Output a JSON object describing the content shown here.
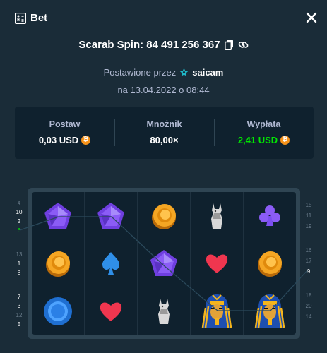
{
  "header": {
    "title": "Bet",
    "bet_icon": "bet-slip-icon",
    "close_icon": "close-icon"
  },
  "spin": {
    "label": "Scarab Spin: 84 491 256 367",
    "copy_icon": "copy-icon",
    "link_icon": "link-icon"
  },
  "placed": {
    "prefix": "Postawione przez",
    "username": "saicam",
    "user_icon": "star-badge-icon",
    "date": "na 13.04.2022 o 08:44"
  },
  "stats": {
    "bet": {
      "label": "Postaw",
      "value": "0,03 USD",
      "currency_icon": "bitcoin-icon"
    },
    "multiplier": {
      "label": "Mnożnik",
      "value": "80,00×"
    },
    "payout": {
      "label": "Wypłata",
      "value": "2,41 USD",
      "currency_icon": "bitcoin-icon",
      "color": "#00e701"
    }
  },
  "board": {
    "rows": [
      [
        "purple-gem",
        "purple-gem",
        "gold-coin",
        "anubis-statue",
        "purple-club"
      ],
      [
        "gold-coin",
        "blue-spade",
        "purple-gem",
        "red-heart",
        "gold-coin"
      ],
      [
        "blue-ring",
        "red-heart",
        "anubis-statue",
        "pharaoh-mask",
        "pharaoh-mask"
      ]
    ],
    "left_numbers": [
      "4",
      "10",
      "2",
      "6",
      "13",
      "1",
      "8",
      "7",
      "3",
      "12",
      "5"
    ],
    "right_numbers": [
      "15",
      "11",
      "19",
      "16",
      "17",
      "9",
      "18",
      "20",
      "14"
    ],
    "highlighted_left": "6",
    "highlighted_right": "9"
  }
}
